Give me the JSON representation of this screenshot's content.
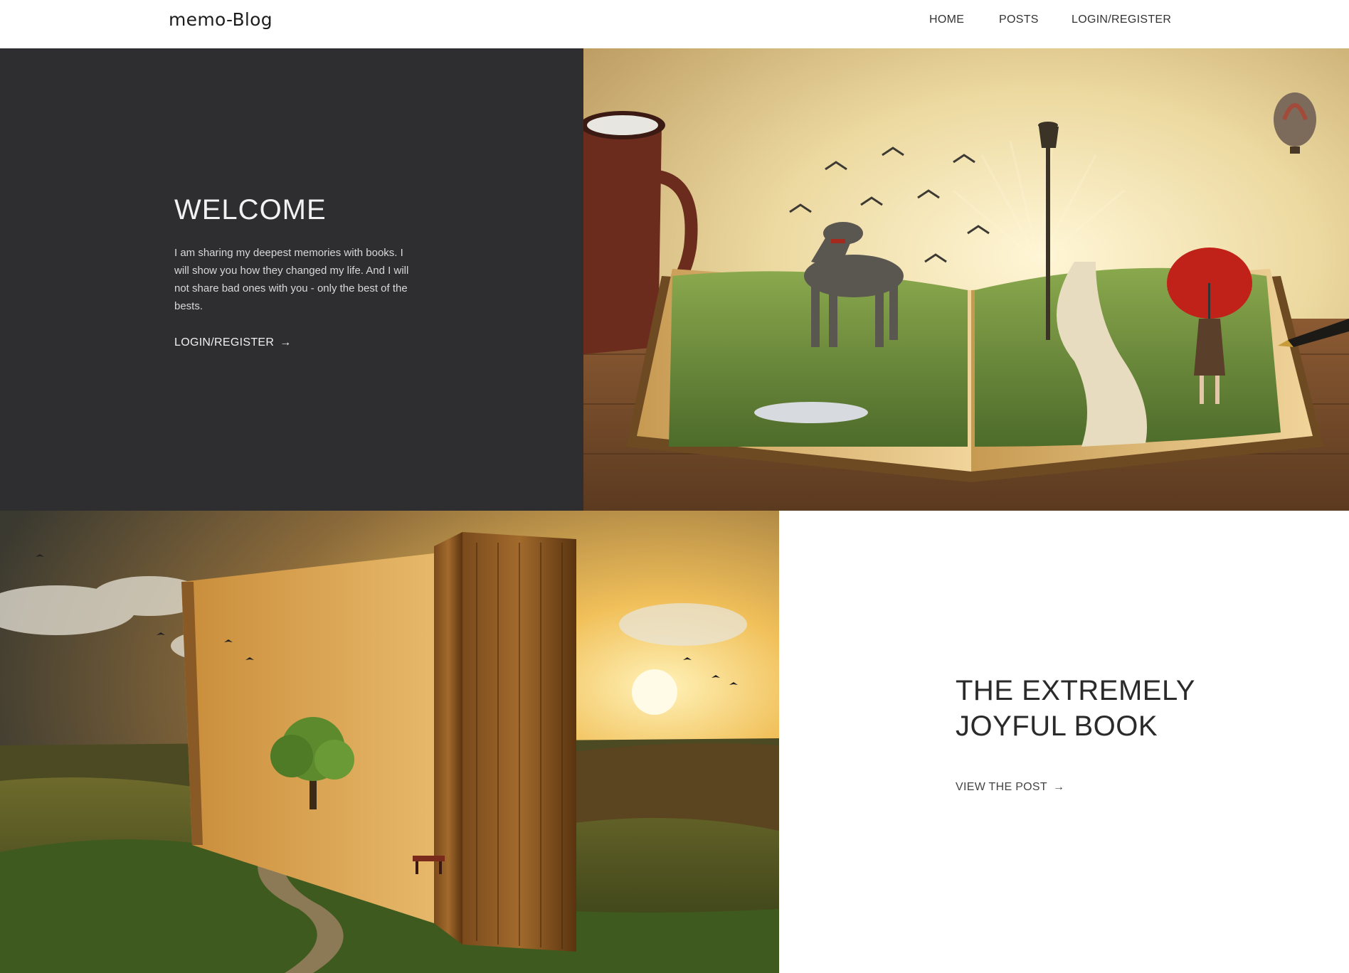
{
  "navbar": {
    "brand": "memo-Blog",
    "links": [
      {
        "label": "HOME"
      },
      {
        "label": "POSTS"
      },
      {
        "label": "LOGIN/REGISTER"
      }
    ]
  },
  "hero": {
    "title": "WELCOME",
    "text": "I am sharing my deepest memories with books. I will show you how they changed my life. And I will not share bad ones with you - only the best of the bests.",
    "cta_label": "LOGIN/REGISTER",
    "cta_icon": "arrow-right-icon",
    "image": "open book with grass landscape, dog, girl with red umbrella, lamp post, birds, hot-air balloon, mug"
  },
  "featured_post": {
    "title": "THE EXTREMELY JOYFUL BOOK",
    "cta_label": "VIEW THE POST",
    "cta_icon": "arrow-right-icon",
    "image": "giant standing book in landscape at sunset with tree and bench"
  },
  "colors": {
    "hero_bg": "#2e2e30",
    "text_dark": "#2a2a2a",
    "text_light": "#f2f2f2"
  }
}
